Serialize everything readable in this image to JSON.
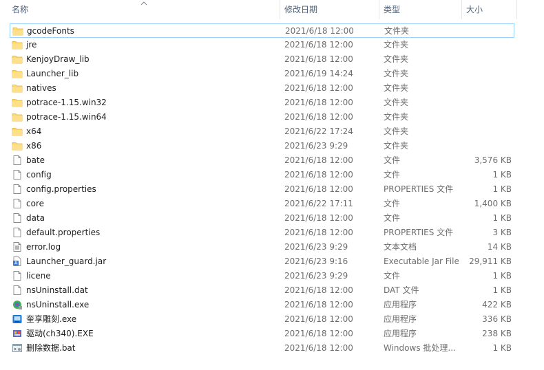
{
  "header": {
    "name_label": "名称",
    "date_label": "修改日期",
    "type_label": "类型",
    "size_label": "大小"
  },
  "files": [
    {
      "name": "gcodeFonts",
      "date": "2021/6/18 12:00",
      "type": "文件夹",
      "size": "",
      "icon": "folder-icon",
      "selected": true
    },
    {
      "name": "jre",
      "date": "2021/6/18 12:00",
      "type": "文件夹",
      "size": "",
      "icon": "folder-icon"
    },
    {
      "name": "KenjoyDraw_lib",
      "date": "2021/6/18 12:00",
      "type": "文件夹",
      "size": "",
      "icon": "folder-icon"
    },
    {
      "name": "Launcher_lib",
      "date": "2021/6/19 14:24",
      "type": "文件夹",
      "size": "",
      "icon": "folder-icon"
    },
    {
      "name": "natives",
      "date": "2021/6/18 12:00",
      "type": "文件夹",
      "size": "",
      "icon": "folder-icon"
    },
    {
      "name": "potrace-1.15.win32",
      "date": "2021/6/18 12:00",
      "type": "文件夹",
      "size": "",
      "icon": "folder-icon"
    },
    {
      "name": "potrace-1.15.win64",
      "date": "2021/6/18 12:00",
      "type": "文件夹",
      "size": "",
      "icon": "folder-icon"
    },
    {
      "name": "x64",
      "date": "2021/6/22 17:24",
      "type": "文件夹",
      "size": "",
      "icon": "folder-icon"
    },
    {
      "name": "x86",
      "date": "2021/6/23 9:29",
      "type": "文件夹",
      "size": "",
      "icon": "folder-icon"
    },
    {
      "name": "bate",
      "date": "2021/6/18 12:00",
      "type": "文件",
      "size": "3,576 KB",
      "icon": "file-icon"
    },
    {
      "name": "config",
      "date": "2021/6/18 12:00",
      "type": "文件",
      "size": "1 KB",
      "icon": "file-icon"
    },
    {
      "name": "config.properties",
      "date": "2021/6/18 12:00",
      "type": "PROPERTIES 文件",
      "size": "1 KB",
      "icon": "file-icon"
    },
    {
      "name": "core",
      "date": "2021/6/22 17:11",
      "type": "文件",
      "size": "1,400 KB",
      "icon": "file-icon"
    },
    {
      "name": "data",
      "date": "2021/6/18 12:00",
      "type": "文件",
      "size": "1 KB",
      "icon": "file-icon"
    },
    {
      "name": "default.properties",
      "date": "2021/6/18 12:00",
      "type": "PROPERTIES 文件",
      "size": "3 KB",
      "icon": "file-icon"
    },
    {
      "name": "error.log",
      "date": "2021/6/23 9:29",
      "type": "文本文档",
      "size": "14 KB",
      "icon": "text-file-icon"
    },
    {
      "name": "Launcher_guard.jar",
      "date": "2021/6/23 9:16",
      "type": "Executable Jar File",
      "size": "29,911 KB",
      "icon": "jar-file-icon"
    },
    {
      "name": "licene",
      "date": "2021/6/23 9:29",
      "type": "文件",
      "size": "1 KB",
      "icon": "file-icon"
    },
    {
      "name": "nsUninstall.dat",
      "date": "2021/6/18 12:00",
      "type": "DAT 文件",
      "size": "1 KB",
      "icon": "file-icon"
    },
    {
      "name": "nsUninstall.exe",
      "date": "2021/6/18 12:00",
      "type": "应用程序",
      "size": "422 KB",
      "icon": "uninstaller-icon"
    },
    {
      "name": "奎享雕刻.exe",
      "date": "2021/6/18 12:00",
      "type": "应用程序",
      "size": "336 KB",
      "icon": "app-icon"
    },
    {
      "name": "驱动(ch340).EXE",
      "date": "2021/6/18 12:00",
      "type": "应用程序",
      "size": "238 KB",
      "icon": "driver-app-icon"
    },
    {
      "name": "删除数据.bat",
      "date": "2021/6/18 12:00",
      "type": "Windows 批处理...",
      "size": "1 KB",
      "icon": "batch-file-icon"
    }
  ]
}
